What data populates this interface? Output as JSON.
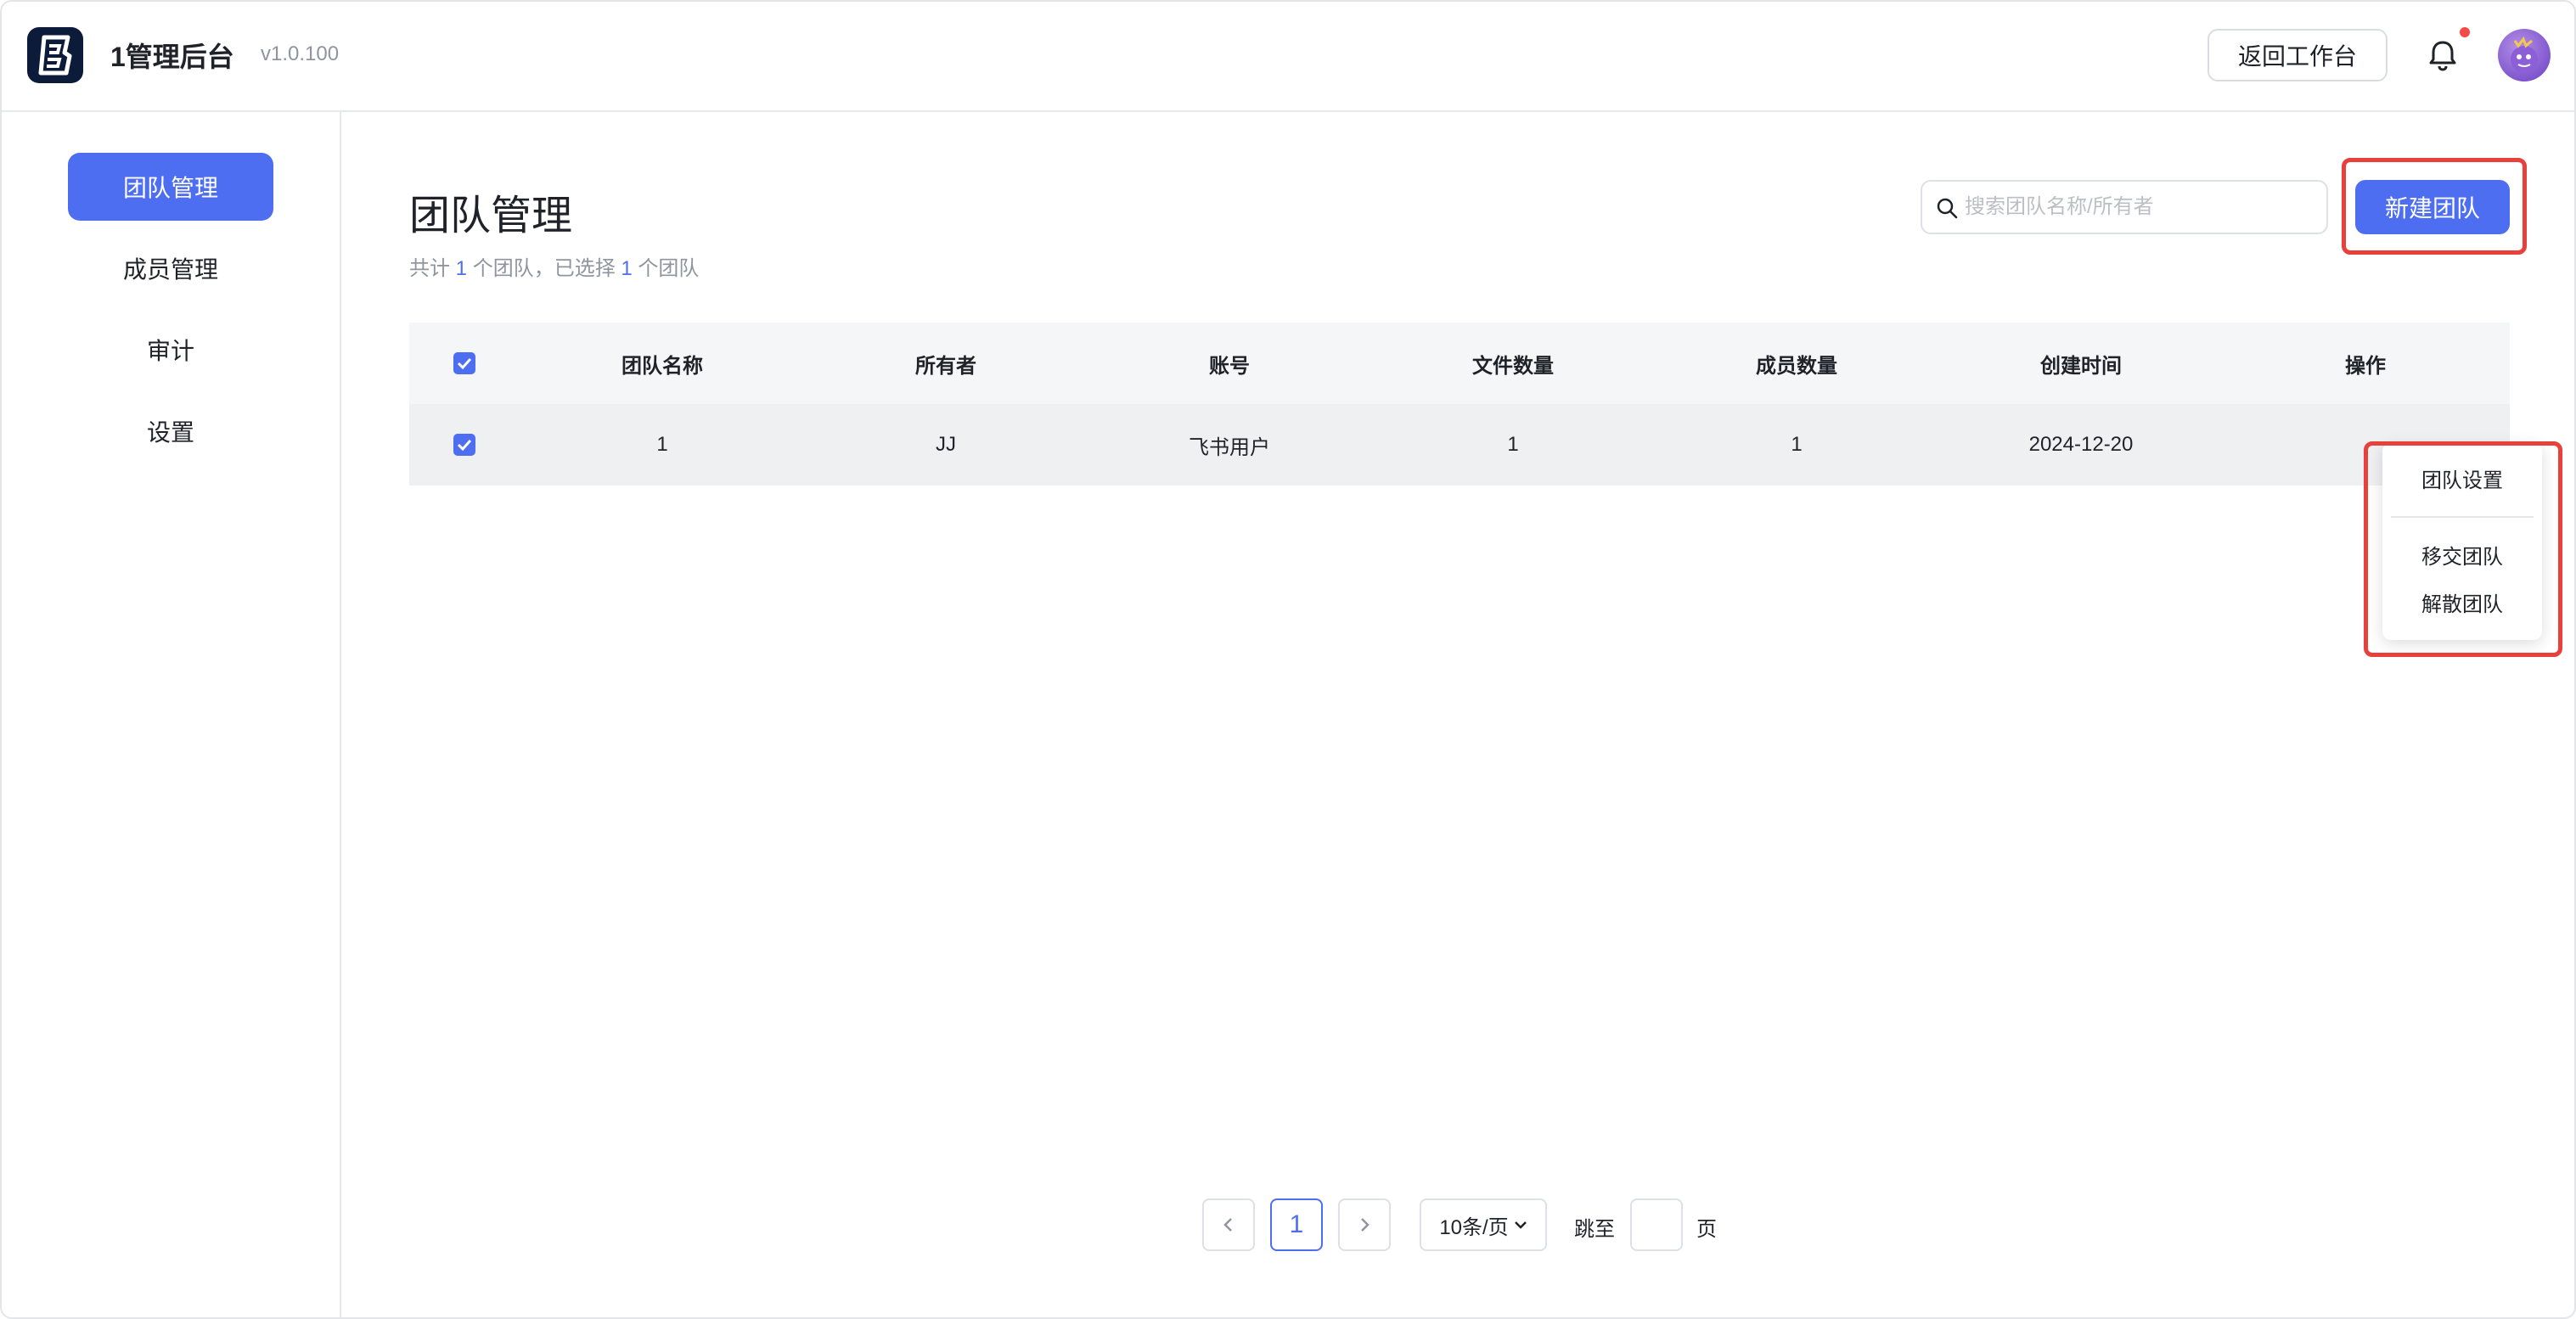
{
  "header": {
    "app_title": "1管理后台",
    "version": "v1.0.100",
    "back_button": "返回工作台",
    "logo_icon": "logo-b-icon",
    "bell_icon": "bell-icon",
    "notification_dot_color": "#f54a45"
  },
  "sidebar": {
    "items": [
      {
        "label": "团队管理",
        "active": true
      },
      {
        "label": "成员管理",
        "active": false
      },
      {
        "label": "审计",
        "active": false
      },
      {
        "label": "设置",
        "active": false
      }
    ]
  },
  "main": {
    "title": "团队管理",
    "subtitle": {
      "prefix": "共计 ",
      "total": "1",
      "middle": " 个团队，已选择 ",
      "selected": "1",
      "suffix": " 个团队"
    },
    "search": {
      "placeholder": "搜索团队名称/所有者",
      "value": ""
    },
    "new_button": "新建团队"
  },
  "table": {
    "header_checkbox_checked": true,
    "columns": [
      "团队名称",
      "所有者",
      "账号",
      "文件数量",
      "成员数量",
      "创建时间",
      "操作"
    ],
    "rows": [
      {
        "checked": true,
        "cells": [
          "1",
          "JJ",
          "飞书用户",
          "1",
          "1",
          "2024-12-20"
        ]
      }
    ]
  },
  "dropdown": {
    "items": [
      "团队设置",
      "移交团队",
      "解散团队"
    ]
  },
  "pagination": {
    "current_page": "1",
    "page_size": "10条/页",
    "jump_label": "跳至",
    "jump_value": "",
    "page_label": "页"
  },
  "colors": {
    "accent": "#4e6ef2",
    "highlight": "#e8403a"
  }
}
